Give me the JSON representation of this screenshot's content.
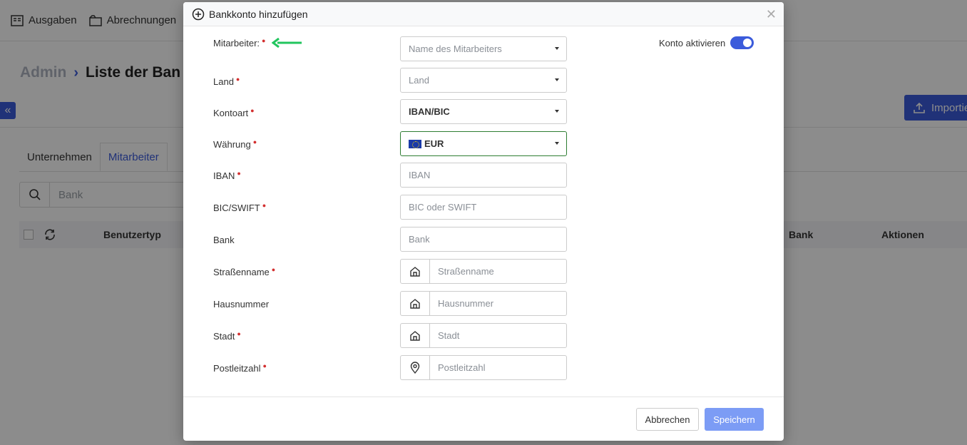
{
  "app": {
    "nav": [
      {
        "label": "Ausgaben",
        "icon": "receipt-icon"
      },
      {
        "label": "Abrechnungen",
        "icon": "folder-icon"
      }
    ],
    "breadcrumb": {
      "root": "Admin",
      "current": "Liste der Ban"
    },
    "import_label": "Importie",
    "tabs": [
      {
        "label": "Unternehmen",
        "active": false
      },
      {
        "label": "Mitarbeiter",
        "active": true
      }
    ],
    "search_placeholder": "Bank",
    "table_headers": {
      "type": "Benutzertyp",
      "bank": "Bank",
      "actions": "Aktionen"
    }
  },
  "modal": {
    "title": "Bankkonto hinzufügen",
    "toggle_label": "Konto aktivieren",
    "toggle_on": true,
    "fields": [
      {
        "label": "Mitarbeiter:",
        "required": true,
        "kind": "select",
        "placeholder": "Name des Mitarbeiters"
      },
      {
        "label": "Land",
        "required": true,
        "kind": "select",
        "placeholder": "Land"
      },
      {
        "label": "Kontoart",
        "required": true,
        "kind": "select",
        "value": "IBAN/BIC"
      },
      {
        "label": "Währung",
        "required": true,
        "kind": "select",
        "value": "EUR",
        "icon": "eu-flag-icon"
      },
      {
        "label": "IBAN",
        "required": true,
        "kind": "input",
        "placeholder": "IBAN"
      },
      {
        "label": "BIC/SWIFT",
        "required": true,
        "kind": "input",
        "placeholder": "BIC oder SWIFT"
      },
      {
        "label": "Bank",
        "required": false,
        "kind": "input",
        "placeholder": "Bank"
      },
      {
        "label": "Straßenname",
        "required": true,
        "kind": "input",
        "placeholder": "Straßenname",
        "icon": "house-icon"
      },
      {
        "label": "Hausnummer",
        "required": false,
        "kind": "input",
        "placeholder": "Hausnummer",
        "icon": "house-icon"
      },
      {
        "label": "Stadt",
        "required": true,
        "kind": "input",
        "placeholder": "Stadt",
        "icon": "house-icon"
      },
      {
        "label": "Postleitzahl",
        "required": true,
        "kind": "input",
        "placeholder": "Postleitzahl",
        "icon": "location-pin-icon"
      }
    ],
    "cancel_label": "Abbrechen",
    "save_label": "Speichern",
    "colors": {
      "accent": "#3b5bdb",
      "save_button": "#7c9cf5",
      "required_dot": "#d32f2f",
      "focus_border": "#2e7d32",
      "annotation_arrow": "#22c55e"
    }
  }
}
